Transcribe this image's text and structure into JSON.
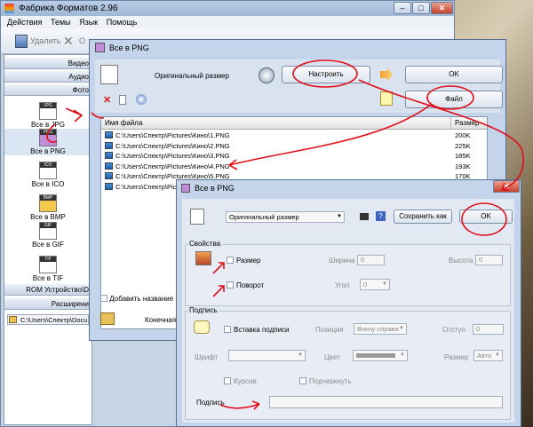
{
  "main": {
    "title": "Фабрика Форматов 2.96",
    "menu": [
      "Действия",
      "Темы",
      "Язык",
      "Помощь"
    ],
    "toolbar": {
      "delete": "Удалить",
      "cancel_partial": "О"
    },
    "categories": {
      "video": "Видео",
      "audio": "Аудио",
      "photo": "Фото",
      "rom": "ROM Устройство\\D",
      "advanced": "Расширени"
    },
    "formats": [
      "Все в JPG",
      "Все в PNG",
      "Все в ICO",
      "Все в BMP",
      "Все в GIF",
      "Все в TIF"
    ],
    "format_badges": [
      "JPG",
      "PNG",
      "ICO",
      "BMP",
      "GIF",
      "TIF"
    ],
    "status_path": "C:\\Users\\Спектр\\Docu"
  },
  "png_window": {
    "title": "Все в PNG",
    "output_size": "Оригинальный размер",
    "configure_button": "Настроить",
    "ok_button": "OK",
    "file_button": "Файл",
    "columns": {
      "name": "Имя файла",
      "size": "Размер"
    },
    "files": [
      {
        "name": "C:\\Users\\Спектр\\Pictures\\Кино\\1.PNG",
        "size": "200K"
      },
      {
        "name": "C:\\Users\\Спектр\\Pictures\\Кино\\2.PNG",
        "size": "225K"
      },
      {
        "name": "C:\\Users\\Спектр\\Pictures\\Кино\\3.PNG",
        "size": "185K"
      },
      {
        "name": "C:\\Users\\Спектр\\Pictures\\Кино\\4.PNG",
        "size": "193K"
      },
      {
        "name": "C:\\Users\\Спектр\\Pictures\\Кино\\5.PNG",
        "size": "170K"
      },
      {
        "name": "C:\\Users\\Спектр\\Pictures\\Кино\\6.PNG",
        "size": ""
      }
    ],
    "add_name_checkbox": "Добавить название (Op",
    "final_folder": "Конечная п"
  },
  "settings_window": {
    "title": "Все в PNG",
    "size_select": "Оригинальный размер",
    "save_as_button": "Сохранить как",
    "ok_button": "OK",
    "properties_title": "Свойства",
    "size_label": "Размер",
    "width_label": "Ширина",
    "width_value": "0",
    "height_label": "Высота",
    "height_value": "0",
    "rotate_label": "Поворот",
    "angle_label": "Угол",
    "angle_value": "0",
    "caption_title": "Подпись",
    "insert_caption_label": "Вставка подписи",
    "position_label": "Позиция",
    "position_value": "Внизу справа",
    "indent_label": "Отступ",
    "indent_value": "0",
    "font_label": "Шрифт",
    "color_label": "Цвет",
    "size2_label": "Размер",
    "size2_value": "Авто",
    "italic_label": "Курсив",
    "underline_label": "Подчеркнуть",
    "caption_label": "Подпись"
  },
  "colors": {
    "annotation_red": "#e0101a",
    "window_frame": "#c4d4ea"
  }
}
